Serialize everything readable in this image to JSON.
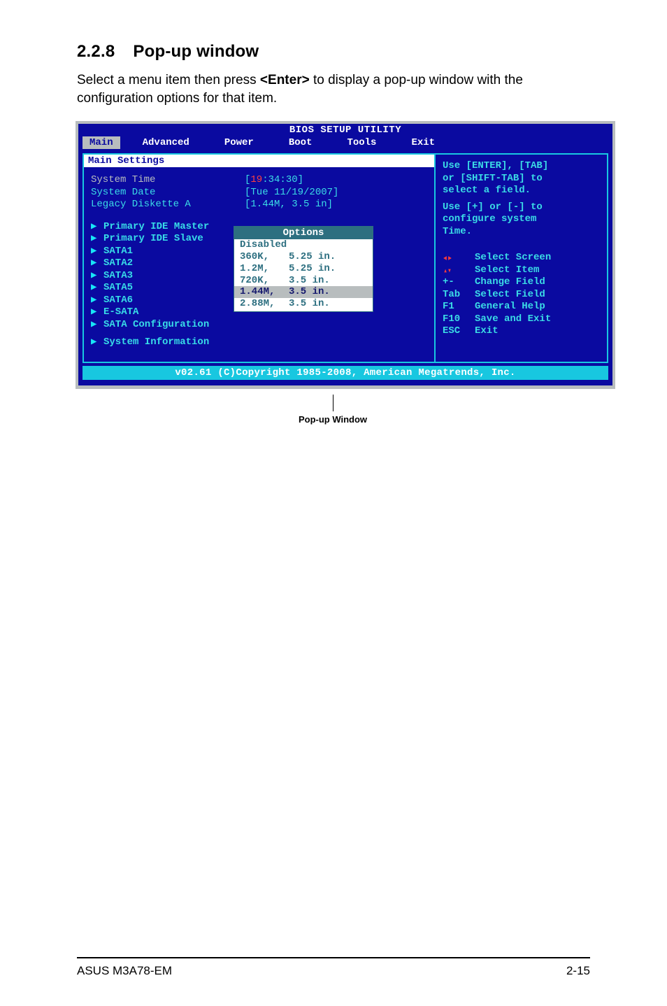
{
  "section": {
    "number": "2.2.8",
    "title": "Pop-up window"
  },
  "intro_pre": "Select a menu item then press ",
  "intro_key": "<Enter>",
  "intro_post": " to display a pop-up window with the configuration options for that item.",
  "bios": {
    "title": "BIOS SETUP UTILITY",
    "tabs": {
      "main": "Main",
      "advanced": "Advanced",
      "power": "Power",
      "boot": "Boot",
      "tools": "Tools",
      "exit": "Exit"
    },
    "main_settings_label": "Main Settings",
    "rows": {
      "system_time": {
        "label": "System Time",
        "hh": "19",
        "mmss": ":34:30]",
        "lbracket": "["
      },
      "system_date": {
        "label": "System Date",
        "value": "[Tue 11/19/2007]"
      },
      "legacy": {
        "label": "Legacy Diskette A",
        "value": "[1.44M, 3.5 in]"
      }
    },
    "submenus": {
      "pim": "Primary IDE Master",
      "pis": "Primary IDE Slave",
      "s1": "SATA1",
      "s2": "SATA2",
      "s3": "SATA3",
      "s5": "SATA5",
      "s6": "SATA6",
      "esata": "E-SATA",
      "satacfg": "SATA Configuration",
      "sysinfo": "System Information"
    },
    "popup": {
      "title": "Options",
      "r0": {
        "c1": "Disabled",
        "c2": ""
      },
      "r1": {
        "c1": "360K,",
        "c2": "5.25 in."
      },
      "r2": {
        "c1": "1.2M,",
        "c2": "5.25 in."
      },
      "r3": {
        "c1": "720K,",
        "c2": "3.5 in."
      },
      "r4": {
        "c1": "1.44M,",
        "c2": "3.5 in."
      },
      "r5": {
        "c1": "2.88M,",
        "c2": "3.5 in."
      }
    },
    "help": {
      "l1": "Use [ENTER], [TAB]",
      "l2": "or [SHIFT-TAB] to",
      "l3": "select a field.",
      "l4": "Use [+] or [-] to",
      "l5": "configure system",
      "l6": "Time."
    },
    "legend": {
      "sel_screen": "Select Screen",
      "sel_item": "Select Item",
      "change_key": "+-",
      "change": "Change Field",
      "tab_key": "Tab",
      "tab": "Select Field",
      "f1_key": "F1",
      "f1": "General Help",
      "f10_key": "F10",
      "f10": "Save and Exit",
      "esc_key": "ESC",
      "esc": "Exit"
    },
    "copyright": "v02.61 (C)Copyright 1985-2008, American Megatrends, Inc."
  },
  "popup_caption": "Pop-up Window",
  "footer": {
    "left": "ASUS M3A78-EM",
    "right": "2-15"
  }
}
